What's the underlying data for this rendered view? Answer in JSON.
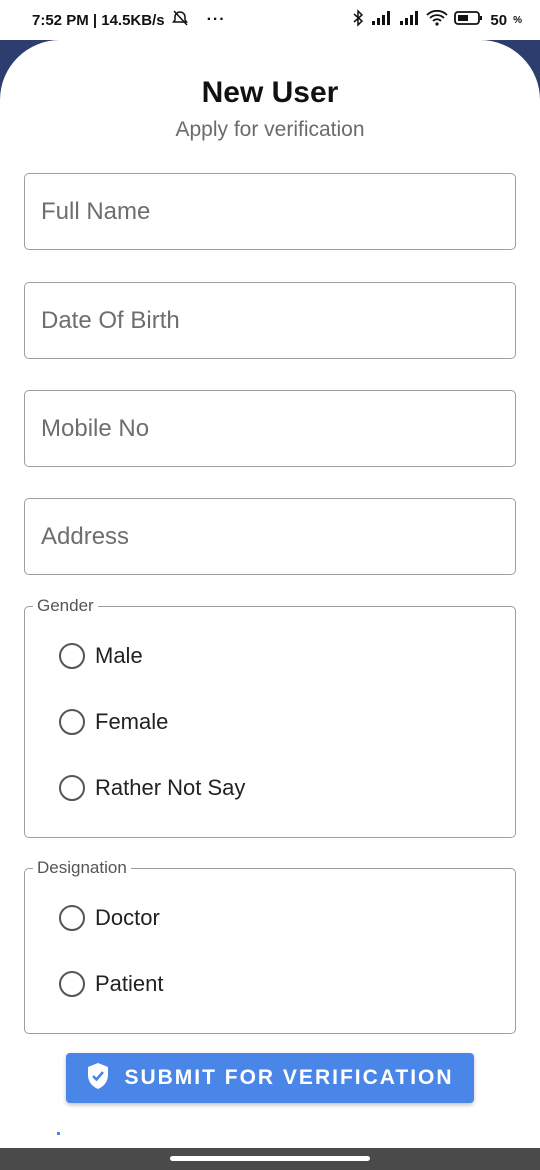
{
  "status_bar": {
    "time_speed": "7:52 PM | 14.5KB/s",
    "more": "···",
    "battery": "50"
  },
  "header": {
    "title": "New User",
    "subtitle": "Apply for verification"
  },
  "form": {
    "full_name_placeholder": "Full Name",
    "dob_placeholder": "Date Of Birth",
    "mobile_placeholder": "Mobile No",
    "address_placeholder": "Address"
  },
  "gender": {
    "legend": "Gender",
    "options": [
      "Male",
      "Female",
      "Rather Not Say"
    ]
  },
  "designation": {
    "legend": "Designation",
    "options": [
      "Doctor",
      "Patient"
    ]
  },
  "submit": {
    "label": "SUBMIT FOR VERIFICATION"
  },
  "colors": {
    "accent": "#4a86e8",
    "header_band": "#2d3e6e"
  }
}
